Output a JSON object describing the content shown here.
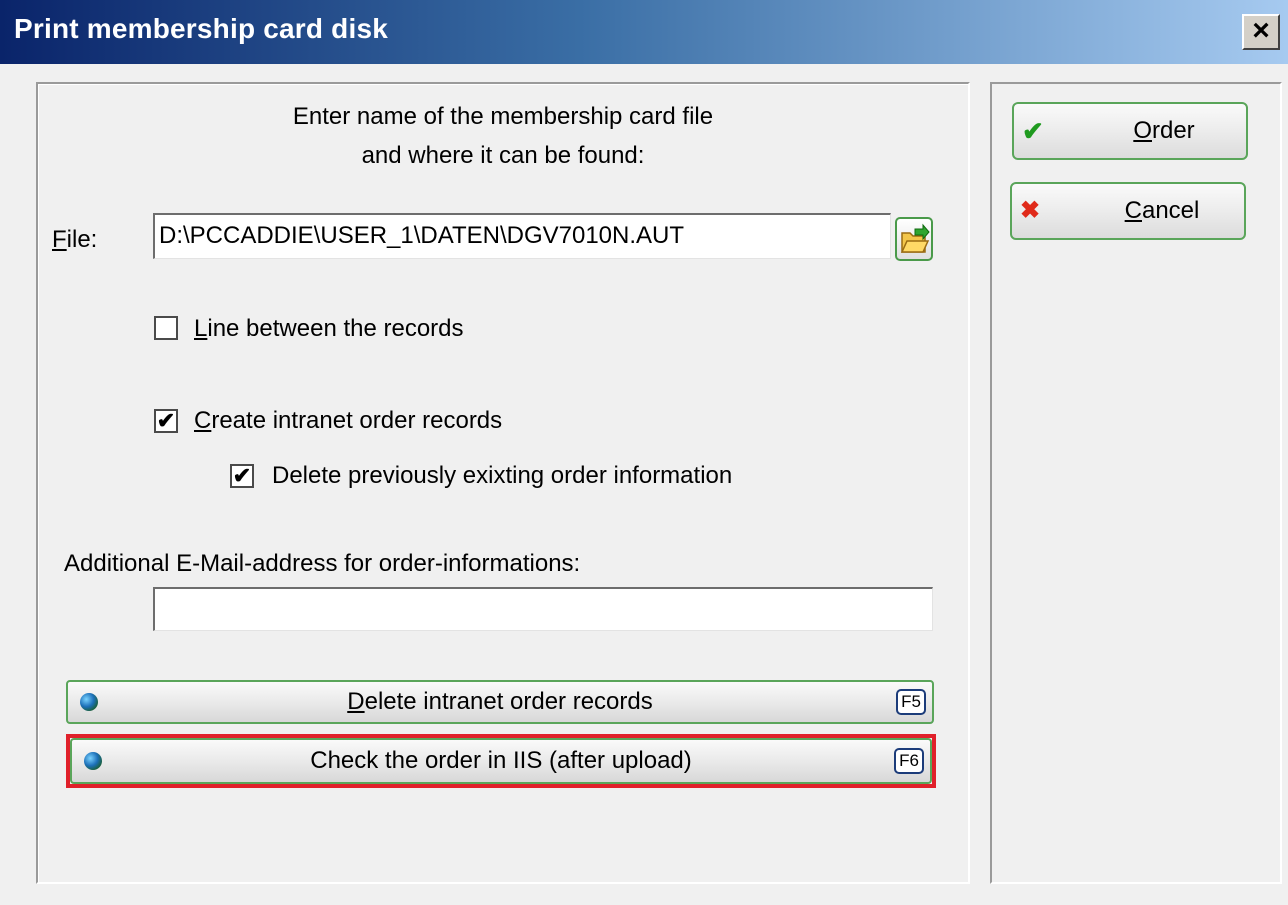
{
  "window": {
    "title": "Print membership card disk",
    "close_label": "×"
  },
  "instructions": {
    "line1": "Enter name of the membership card file",
    "line2": "and where it can be found:"
  },
  "file": {
    "label_prefix": "",
    "label_underlined": "F",
    "label_rest": "ile:",
    "value": "D:\\PCCADDIE\\USER_1\\DATEN\\DGV7010N.AUT",
    "browse_icon": "folder-open-icon"
  },
  "checkboxes": {
    "line_between": {
      "underlined": "L",
      "rest": "ine between the records",
      "checked": false
    },
    "create_intranet": {
      "underlined": "C",
      "rest": "reate intranet order records",
      "checked": true
    },
    "delete_previous": {
      "label": "Delete previously exixting order information",
      "checked": true
    }
  },
  "email": {
    "label": "Additional E-Mail-address for order-informations:",
    "value": ""
  },
  "buttons": {
    "delete_intranet": {
      "underlined": "D",
      "rest": "elete intranet order records",
      "fkey": "F5",
      "icon": "globe-icon"
    },
    "check_order": {
      "label": "Check the order in IIS (after upload)",
      "fkey": "F6",
      "icon": "globe-icon"
    },
    "order": {
      "underlined": "O",
      "rest": "rder",
      "icon": "checkmark-icon"
    },
    "cancel": {
      "underlined": "C",
      "rest": "ancel",
      "icon": "x-icon"
    }
  },
  "colors": {
    "highlight": "#e0202a",
    "button_border": "#5aa55a"
  }
}
